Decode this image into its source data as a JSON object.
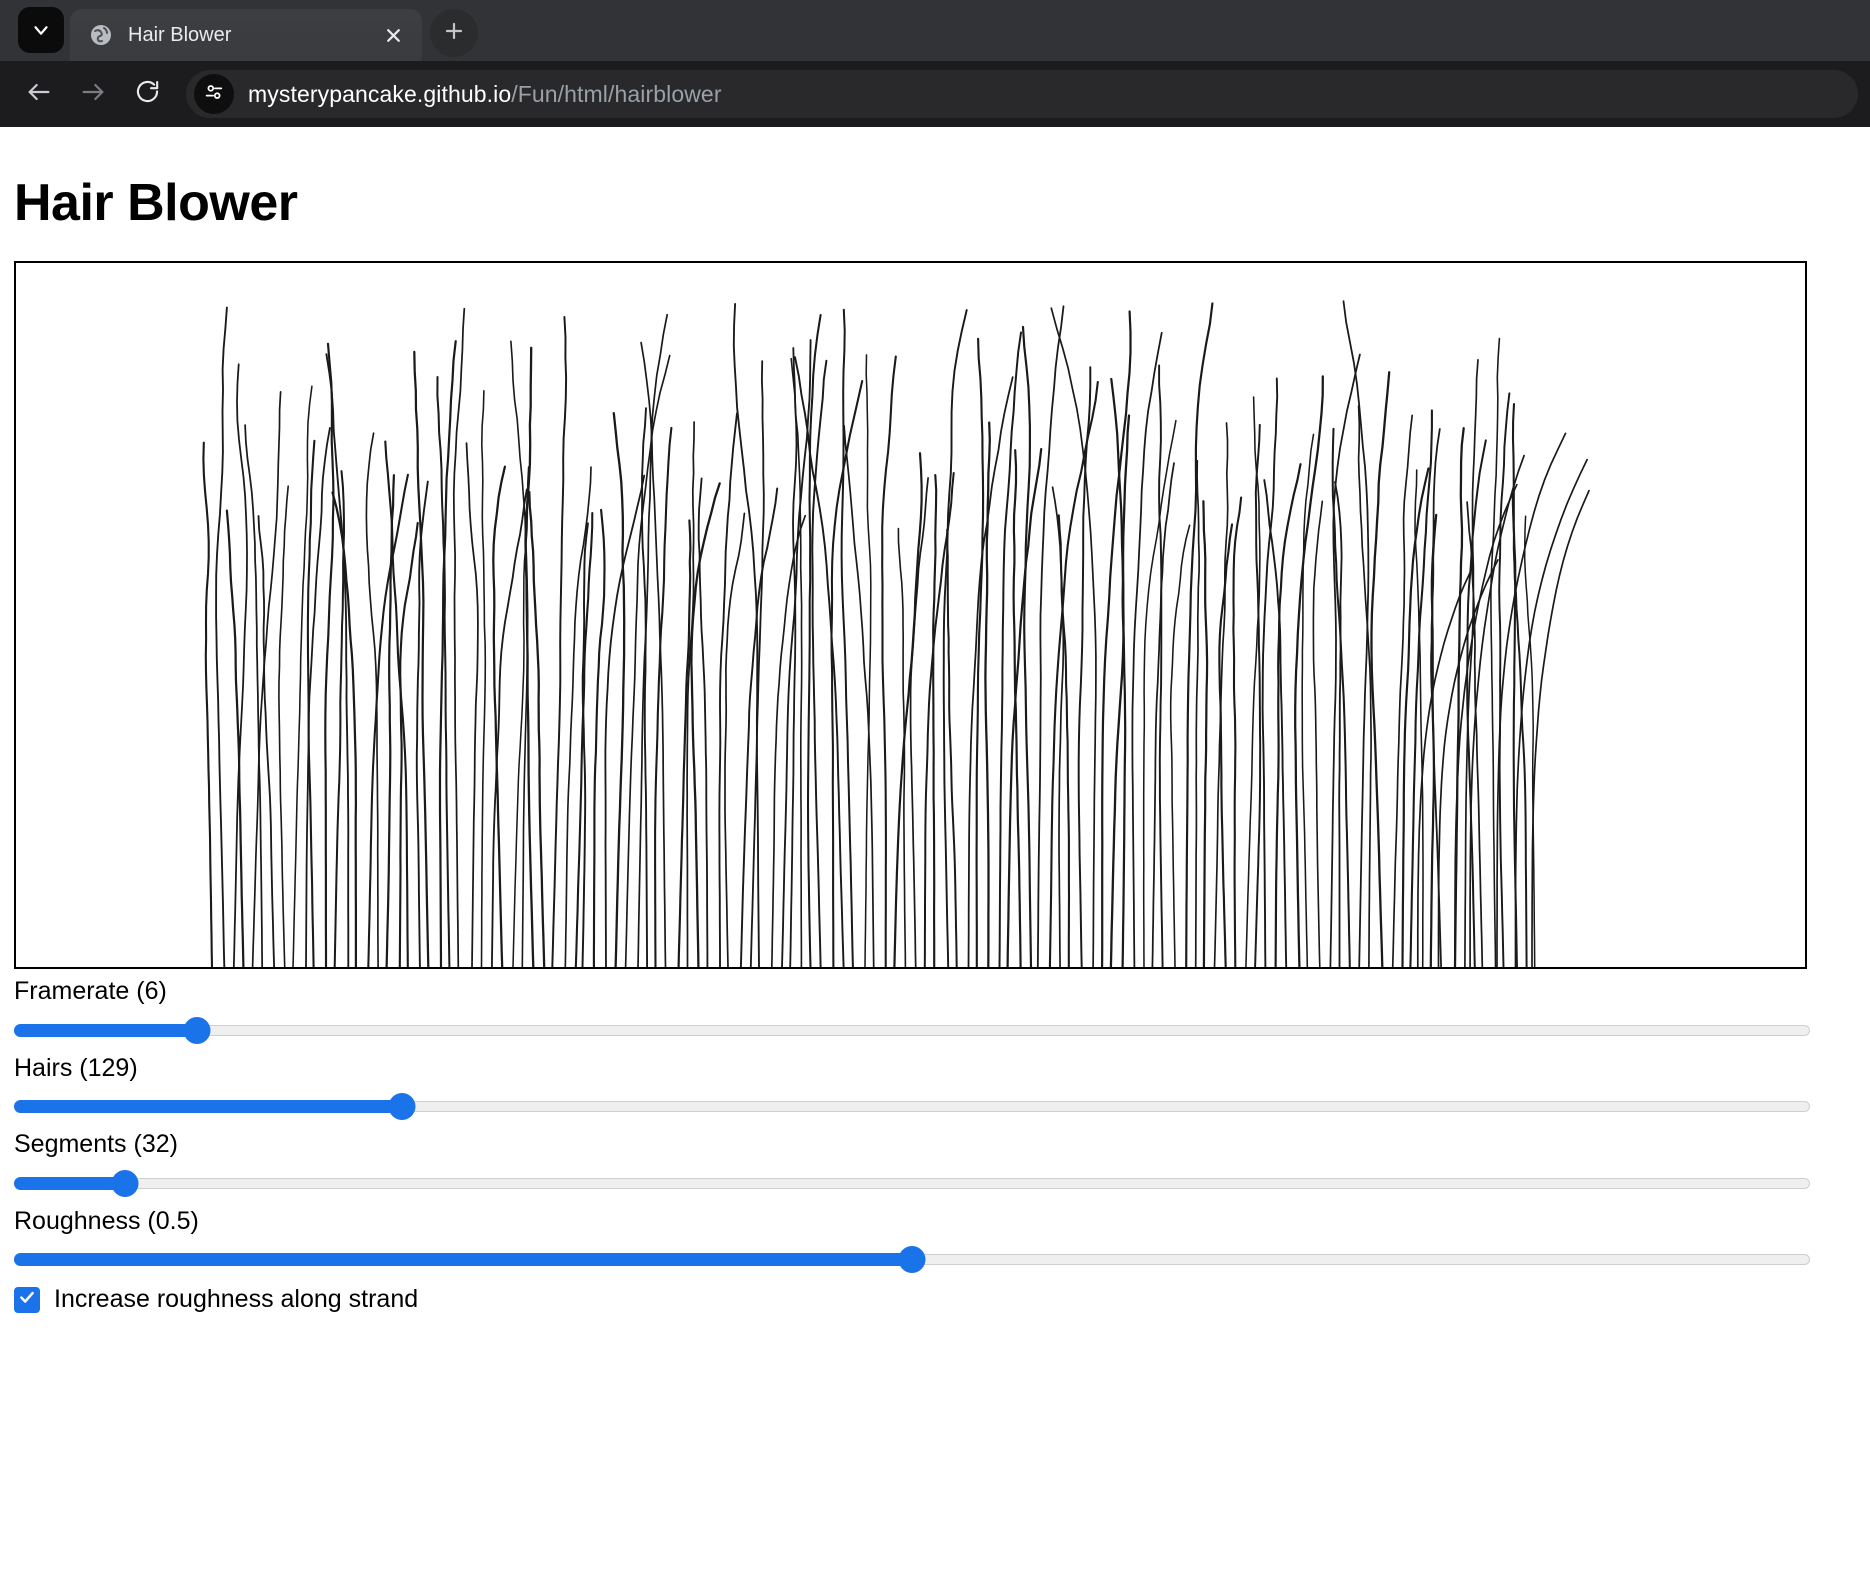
{
  "browser": {
    "tab_search_icon": "chevron-down-icon",
    "tab": {
      "favicon": "globe-icon",
      "title": "Hair Blower",
      "close_icon": "close-icon"
    },
    "new_tab_icon": "plus-icon",
    "toolbar": {
      "back_icon": "back-arrow-icon",
      "forward_icon": "forward-arrow-icon",
      "reload_icon": "reload-icon",
      "site_info_icon": "tune-icon",
      "url_host": "mysterypancake.github.io",
      "url_path": "/Fun/html/hairblower"
    },
    "colors": {
      "tab_strip_bg": "#323336",
      "active_tab_bg": "#3d3e41",
      "toolbar_bg": "#1c1c1e",
      "omnibox_bg": "#29292b",
      "url_host_color": "#ffffff",
      "url_path_color": "#9aa0a6"
    }
  },
  "page": {
    "title": "Hair Blower"
  },
  "canvas": {
    "name": "hair-simulation-canvas",
    "stroke_color": "#1a1a1a",
    "background": "#ffffff",
    "border_color": "#000000"
  },
  "controls": {
    "accent_color": "#1a73e8",
    "track_color": "#efefef",
    "sliders": [
      {
        "name": "framerate",
        "label": "Framerate (6)",
        "value": 6,
        "percent": 10.2
      },
      {
        "name": "hairs",
        "label": "Hairs (129)",
        "value": 129,
        "percent": 21.6
      },
      {
        "name": "segments",
        "label": "Segments (32)",
        "value": 32,
        "percent": 6.2
      },
      {
        "name": "roughness",
        "label": "Roughness (0.5)",
        "value": 0.5,
        "percent": 50.0
      }
    ],
    "checkbox": {
      "label": "Increase roughness along strand",
      "checked": true,
      "check_icon": "check-icon"
    }
  },
  "chart_data": {
    "type": "line",
    "title": "Hair Blower simulation",
    "description": "Procedural hair strand simulation rendered on a white canvas as thin dark curved polylines rising from a baseline.",
    "hair_count": 129,
    "segments_per_hair": 32,
    "roughness": 0.5,
    "framerate": 6,
    "increase_roughness_along_strand": true,
    "stroke_color": "#1a1a1a",
    "xlabel": "",
    "ylabel": "",
    "grid": false,
    "legend": "none"
  }
}
